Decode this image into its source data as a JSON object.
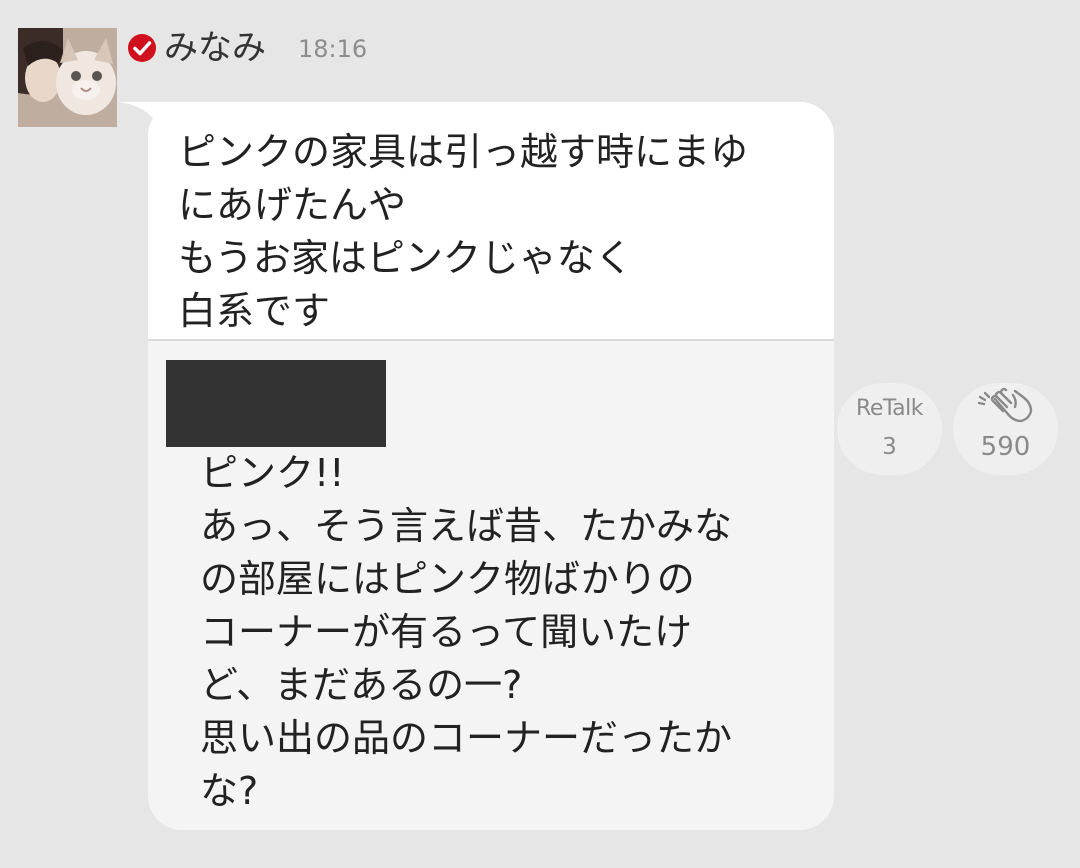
{
  "post": {
    "author": "みなみ",
    "time": "18:16",
    "verified_icon": "check-circle-icon",
    "message": "ピンクの家具は引っ越す時にまゆ\nにあげたんや\nもうお家はピンクじゃなく\n白系です",
    "quoted": {
      "text": "ピンク!!\nあっ、そう言えば昔、たかみな\nの部屋にはピンク物ばかりの\nコーナーが有るって聞いたけ\nど、まだあるの一?\n思い出の品のコーナーだったか\nな?"
    }
  },
  "actions": {
    "retalk": {
      "label": "ReTalk",
      "count": "3"
    },
    "clap": {
      "icon": "clapping-hands-icon",
      "count": "590"
    }
  },
  "colors": {
    "background": "#e6e6e6",
    "bubble": "#ffffff",
    "quoted_background": "#f4f4f4",
    "verified": "#d0101c",
    "redaction": "#333333"
  }
}
